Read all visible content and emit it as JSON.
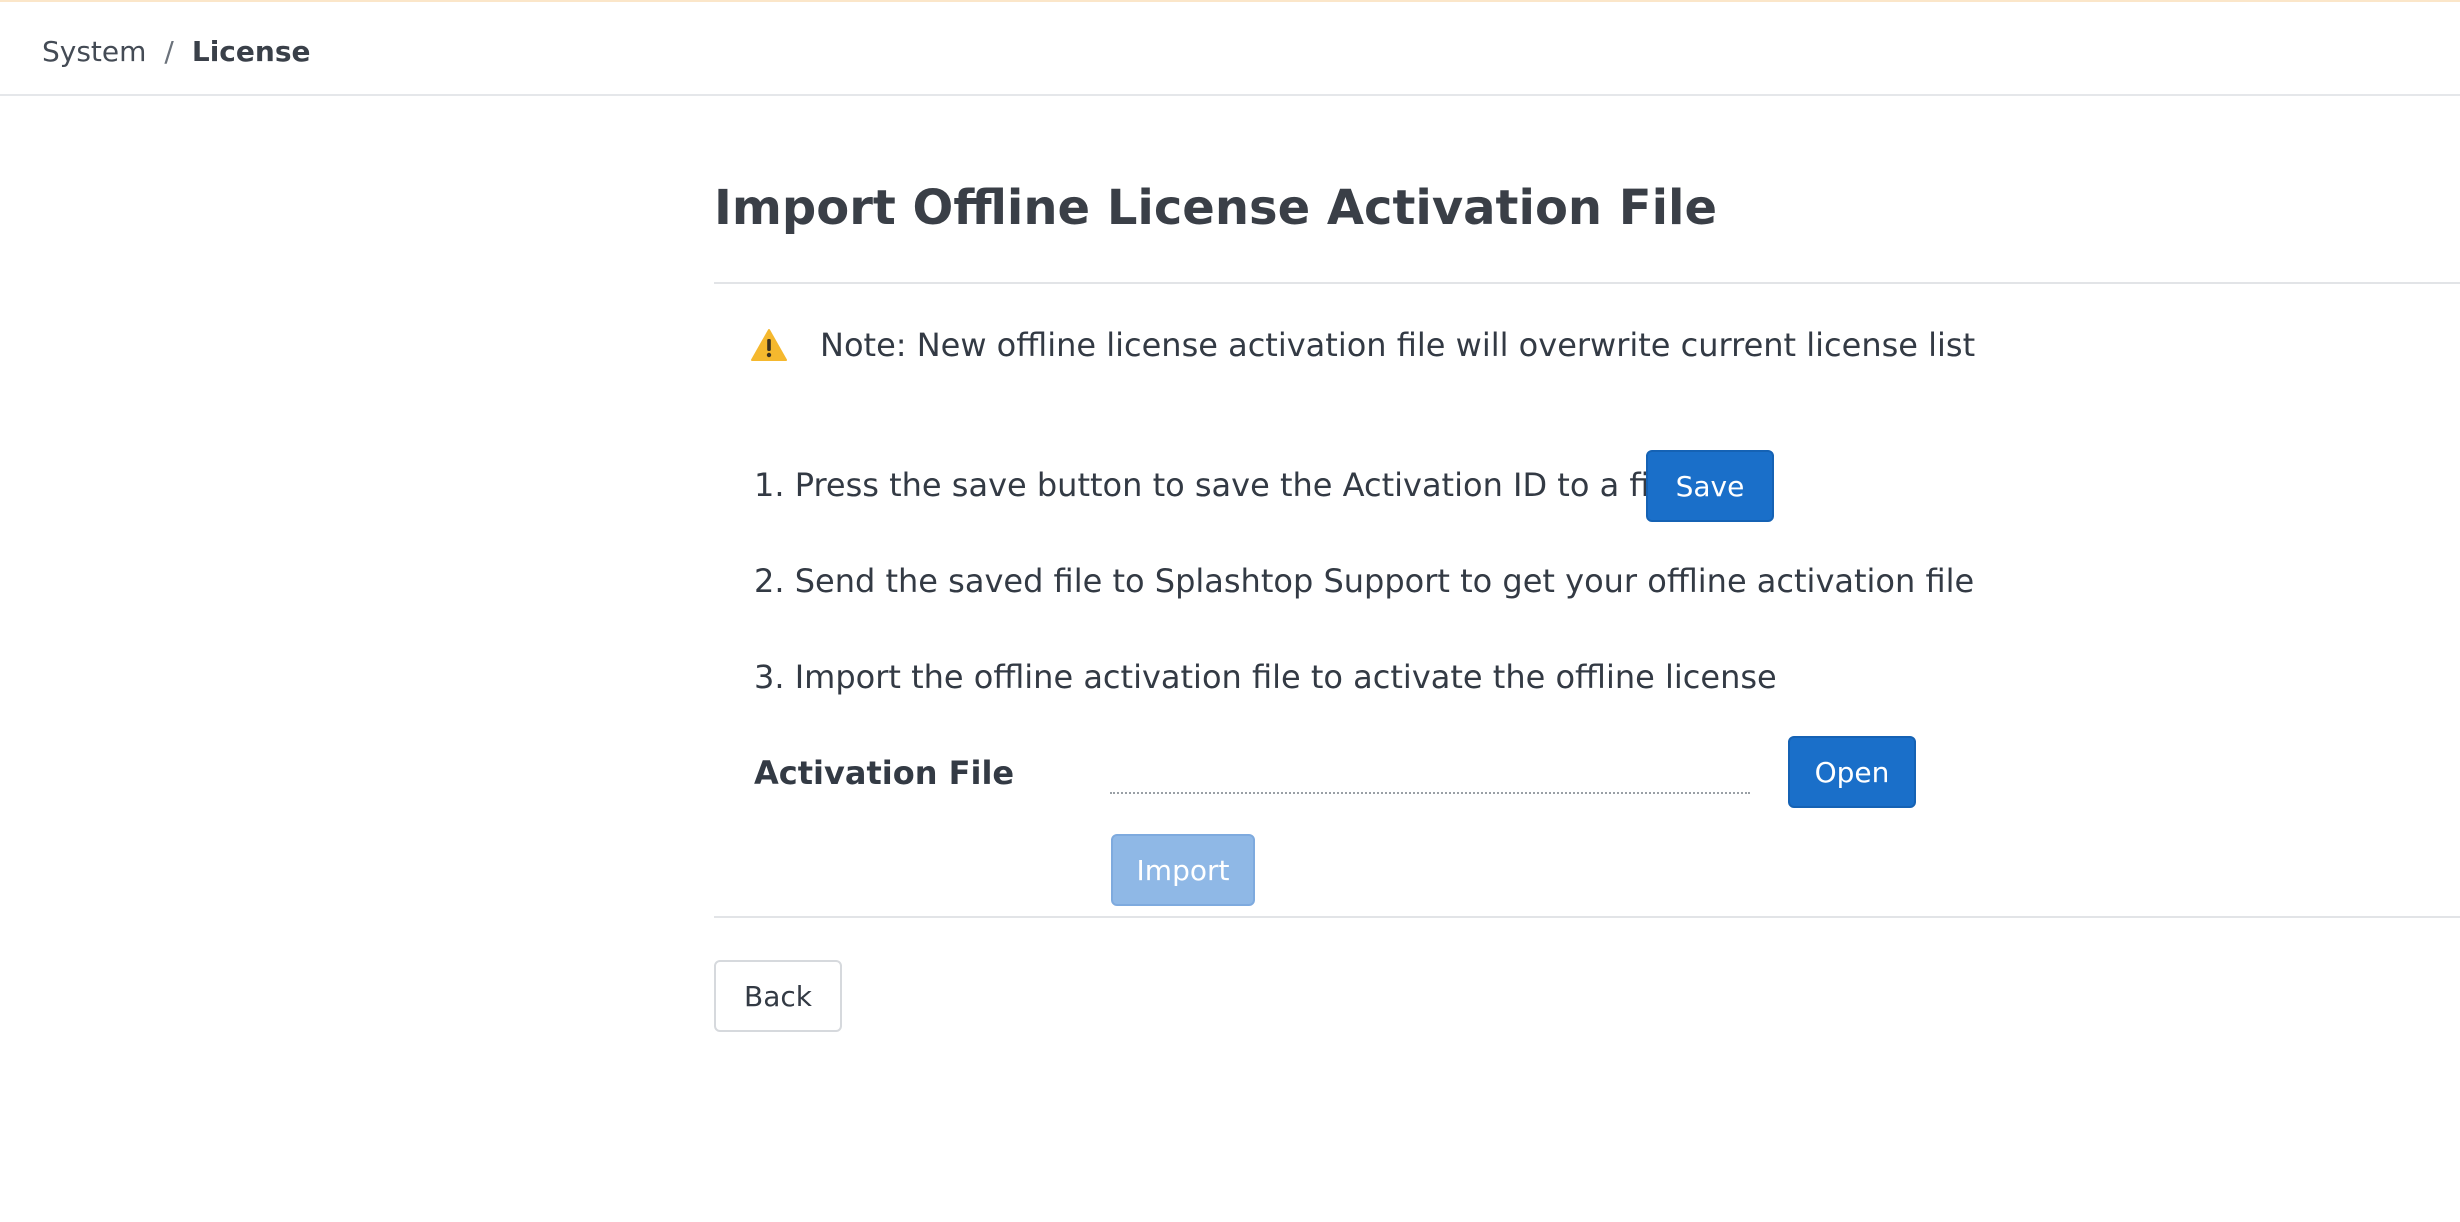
{
  "breadcrumb": {
    "items": [
      "System",
      "License"
    ],
    "separator": "/"
  },
  "page": {
    "title": "Import Offline License Activation File"
  },
  "note": {
    "icon": "warning-icon",
    "text": "Note: New offline license activation file will overwrite current license list"
  },
  "steps": [
    "1. Press the save button to save the Activation ID to a file",
    "2. Send the saved file to Splashtop Support to get your offline activation file",
    "3. Import the offline activation file to activate the offline license"
  ],
  "buttons": {
    "save": "Save",
    "open": "Open",
    "import": "Import",
    "back": "Back"
  },
  "activation_file": {
    "label": "Activation File",
    "value": "",
    "placeholder": ""
  },
  "colors": {
    "primary": "#1a6fc9",
    "disabled": "#8fb8e6",
    "warning": "#f5b82e",
    "top_accent": "#fbe6c9"
  }
}
